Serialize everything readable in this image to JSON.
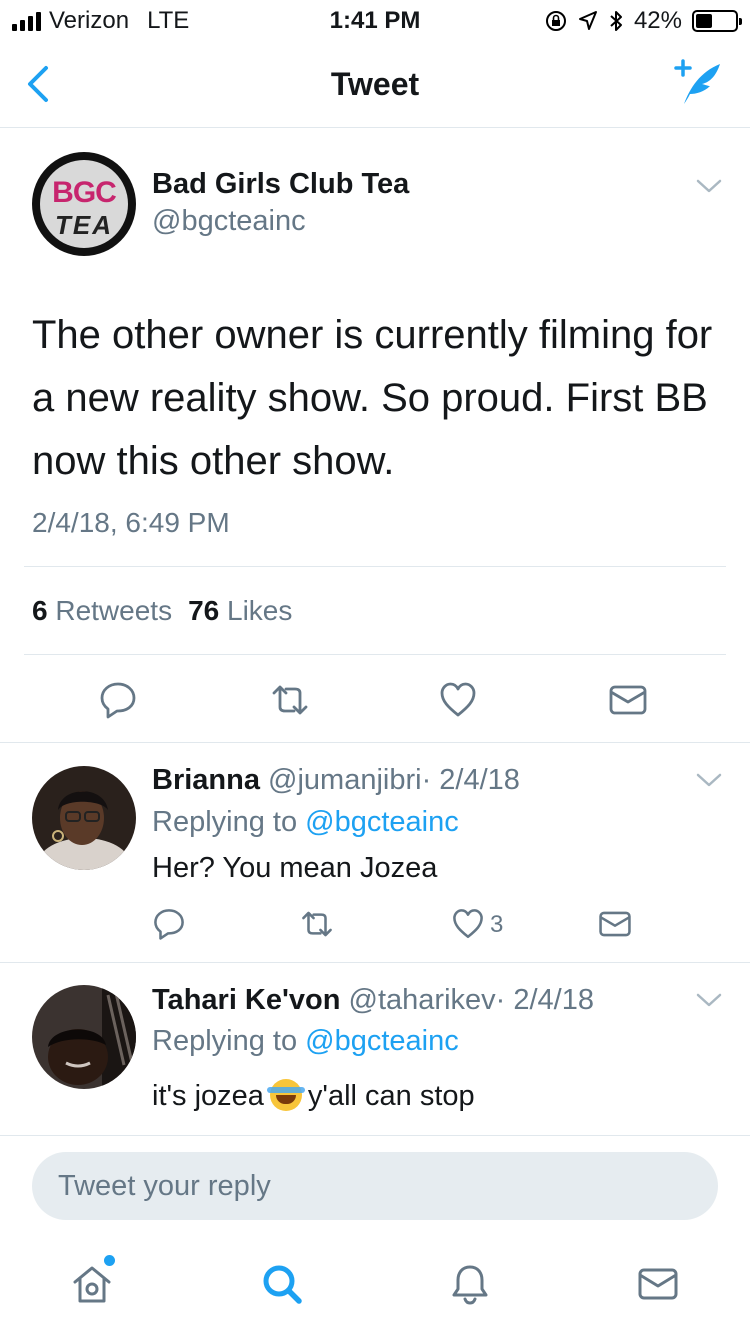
{
  "status_bar": {
    "carrier": "Verizon",
    "network": "LTE",
    "time": "1:41 PM",
    "battery": "42%",
    "battery_level": 0.42
  },
  "nav": {
    "title": "Tweet",
    "back_icon": "chevron-left-icon",
    "compose_icon": "compose-tweet-icon"
  },
  "tweet": {
    "author_name": "Bad Girls Club Tea",
    "author_handle": "@bgcteainc",
    "avatar_logo_top": "BGC",
    "avatar_logo_bottom": "TEA",
    "text": "The other owner is currently filming for a new reality show. So proud. First BB now this other show.",
    "timestamp": "2/4/18, 6:49 PM",
    "retweets_count": "6",
    "retweets_label": "Retweets",
    "likes_count": "76",
    "likes_label": "Likes"
  },
  "replies": [
    {
      "name": "Brianna",
      "handle": "@jumanjibri",
      "date": "· 2/4/18",
      "replying_prefix": "Replying to",
      "replying_to": "@bgcteainc",
      "text": "Her? You mean Jozea",
      "like_count": "3"
    },
    {
      "name": "Tahari Ke'von",
      "handle": "@taharikev",
      "date": "· 2/4/18",
      "replying_prefix": "Replying to",
      "replying_to": "@bgcteainc",
      "text_before": "it's jozea",
      "text_after": "y'all can stop",
      "emoji": "face-with-tears-of-joy"
    }
  ],
  "composer": {
    "placeholder": "Tweet your reply"
  },
  "colors": {
    "accent": "#1da1f2",
    "secondary_text": "#657786",
    "divider": "#e1e8ed",
    "logo_pink": "#c7256e"
  }
}
